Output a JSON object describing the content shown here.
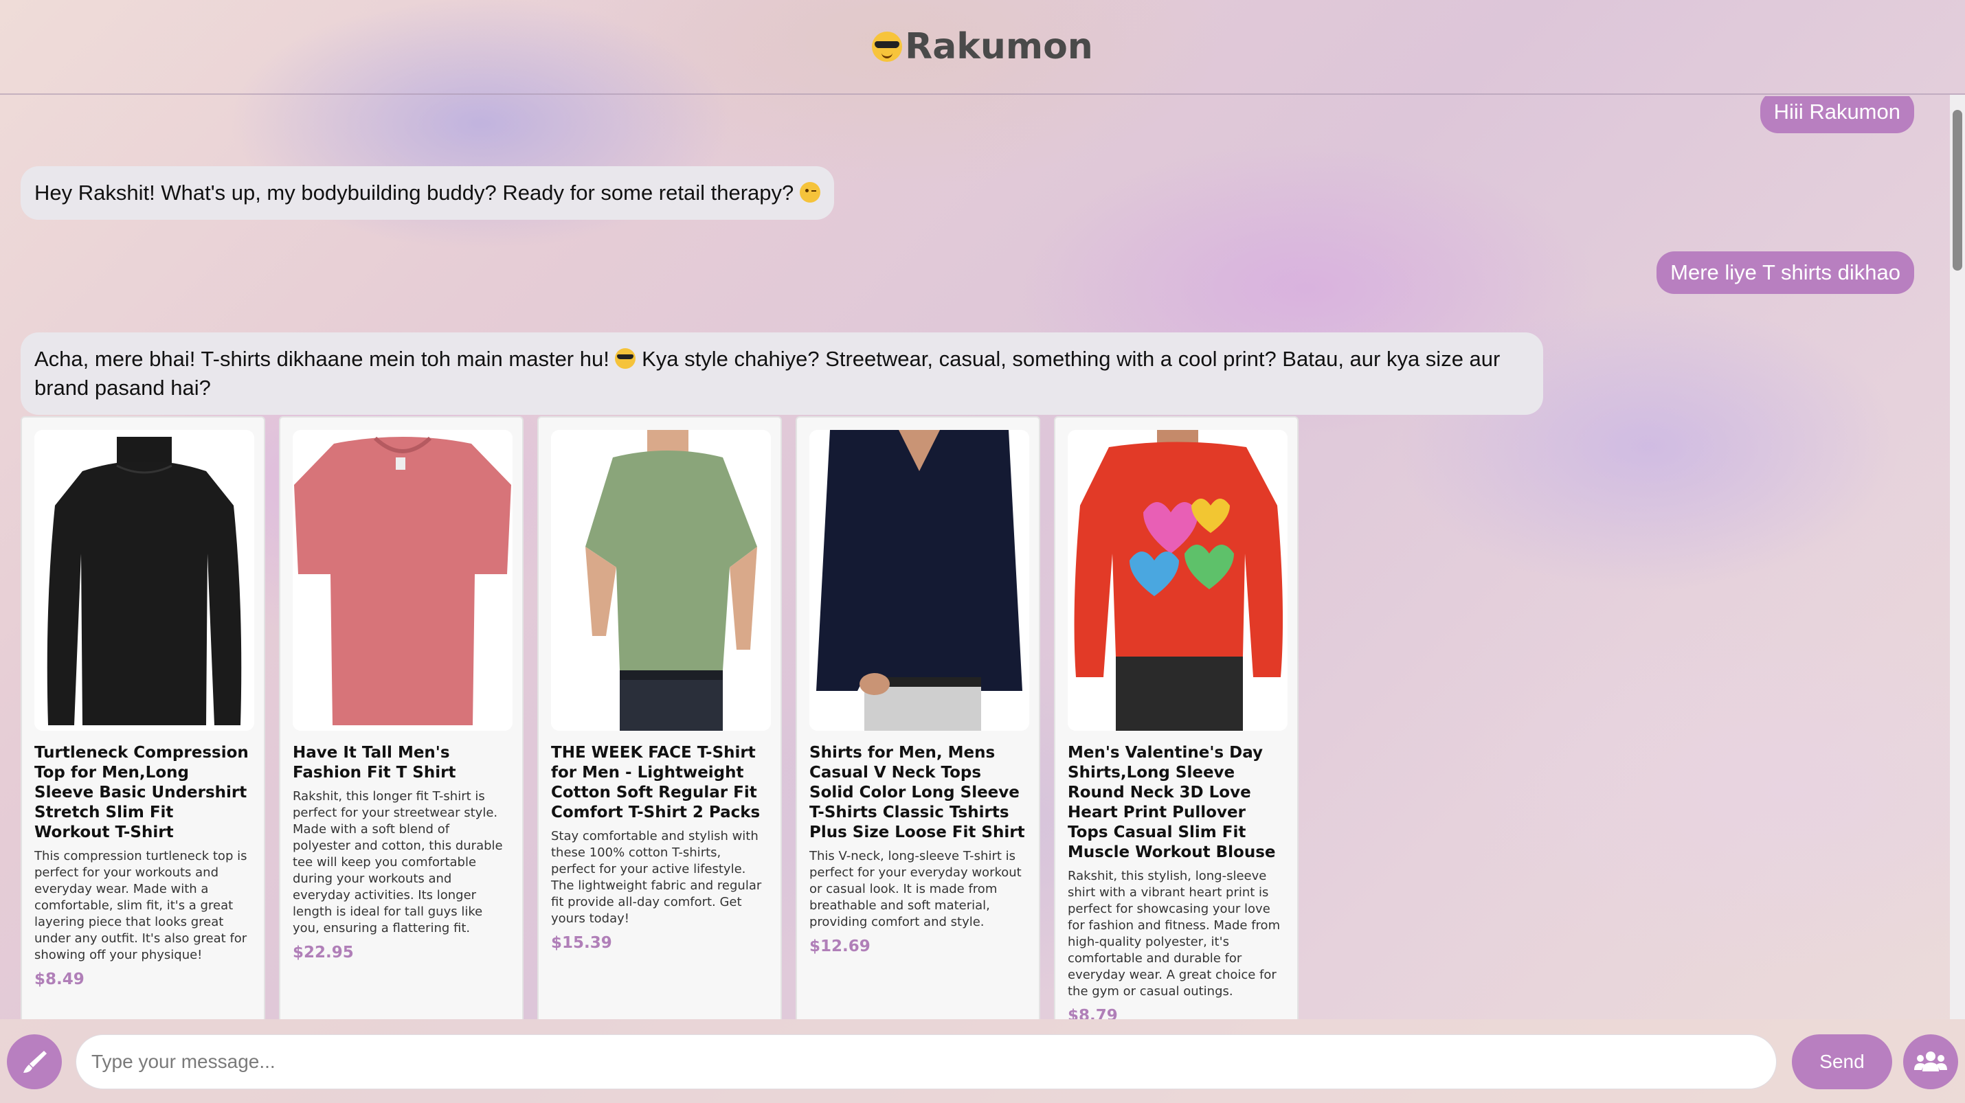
{
  "app": {
    "title": "Rakumon",
    "accent": "#b87fc0"
  },
  "messages": [
    {
      "role": "user",
      "text": "Hiii Rakumon"
    },
    {
      "role": "bot",
      "text": "Hey Rakshit! What's up, my bodybuilding buddy? Ready for some retail therapy?",
      "emoji": "wink-face"
    },
    {
      "role": "user",
      "text": "Mere liye T shirts dikhao"
    },
    {
      "role": "bot",
      "text_before_emoji": "Acha, mere bhai! T-shirts dikhaane mein toh main master hu!",
      "emoji": "sunglasses-face",
      "text_after_emoji": "Kya style chahiye? Streetwear, casual, something with a cool print? Batau, aur kya size aur brand pasand hai?"
    }
  ],
  "products": [
    {
      "name": "Turtleneck Compression Top for Men,Long Sleeve Basic Undershirt Stretch Slim Fit Workout T-Shirt",
      "description": "This compression turtleneck top is perfect for your workouts and everyday wear. Made with a comfortable, slim fit, it's a great layering piece that looks great under any outfit. It's also great for showing off your physique!",
      "price": "$8.49",
      "image": "black-turtleneck-long-sleeve",
      "color": "#1b1b1b"
    },
    {
      "name": "Have It Tall Men's Fashion Fit T Shirt",
      "description": "Rakshit, this longer fit T-shirt is perfect for your streetwear style. Made with a soft blend of polyester and cotton, this durable tee will keep you comfortable during your workouts and everyday activities. Its longer length is ideal for tall guys like you, ensuring a flattering fit.",
      "price": "$22.95",
      "image": "pink-crew-tshirt",
      "color": "#d8747a"
    },
    {
      "name": "THE WEEK FACE T-Shirt for Men - Lightweight Cotton Soft Regular Fit Comfort T-Shirt 2 Packs",
      "description": "Stay comfortable and stylish with these 100% cotton T-shirts, perfect for your active lifestyle. The lightweight fabric and regular fit provide all-day comfort. Get yours today!",
      "price": "$15.39",
      "image": "green-tshirt-model",
      "color": "#8aa57a"
    },
    {
      "name": "Shirts for Men, Mens Casual V Neck Tops Solid Color Long Sleeve T-Shirts Classic Tshirts Plus Size Loose Fit Shirt",
      "description": "This V-neck, long-sleeve T-shirt is perfect for your everyday workout or casual look. It is made from breathable and soft material, providing comfort and style.",
      "price": "$12.69",
      "image": "navy-vneck-long-sleeve",
      "color": "#151a33"
    },
    {
      "name": "Men's Valentine's Day Shirts,Long Sleeve Round Neck 3D Love Heart Print Pullover Tops Casual Slim Fit Muscle Workout Blouse",
      "description": "Rakshit, this stylish, long-sleeve shirt with a vibrant heart print is perfect for showcasing your love for fashion and fitness. Made from high-quality polyester, it's comfortable and durable for everyday wear. A great choice for the gym or casual outings.",
      "price": "$8.79",
      "image": "red-heart-print-long-sleeve",
      "color": "#e03a26"
    }
  ],
  "input": {
    "placeholder": "Type your message...",
    "value": ""
  },
  "buttons": {
    "send": "Send",
    "theme_icon": "paintbrush-icon",
    "users_icon": "users-icon"
  }
}
